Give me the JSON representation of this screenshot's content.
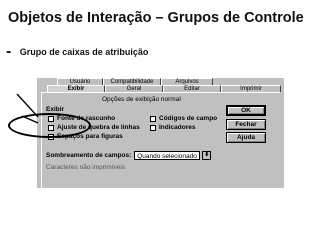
{
  "slide": {
    "title": "Objetos de Interação – Grupos de Controle",
    "subtitle_dash": "-",
    "subtitle": "Grupo de caixas de atribuição"
  },
  "dialog": {
    "tabs_back": [
      "Usuário",
      "Compatibilidade",
      "Arquivos"
    ],
    "tabs_front": [
      "Exibir",
      "Geral",
      "Editar",
      "Imprimir"
    ],
    "active_tab": "Exibir",
    "group_title": "Opções de exibição normal",
    "section_label": "Exibir",
    "checkboxes_left": [
      {
        "label": "Fonte de rascunho",
        "checked": false
      },
      {
        "label": "Ajuste de quebra de linhas",
        "checked": false
      },
      {
        "label": "Espaços para figuras",
        "checked": false
      }
    ],
    "checkboxes_right": [
      {
        "label": "Códigos de campo",
        "checked": false
      },
      {
        "label": "Indicadores",
        "checked": false
      }
    ],
    "select": {
      "label": "Sombreamento de campos:",
      "value": "Quando selecionado",
      "arrow": "⬇"
    },
    "faded_text": "Caracteres não imprimíveis",
    "buttons": {
      "ok": "OK",
      "close": "Fechar",
      "help": "Ajuda"
    }
  }
}
